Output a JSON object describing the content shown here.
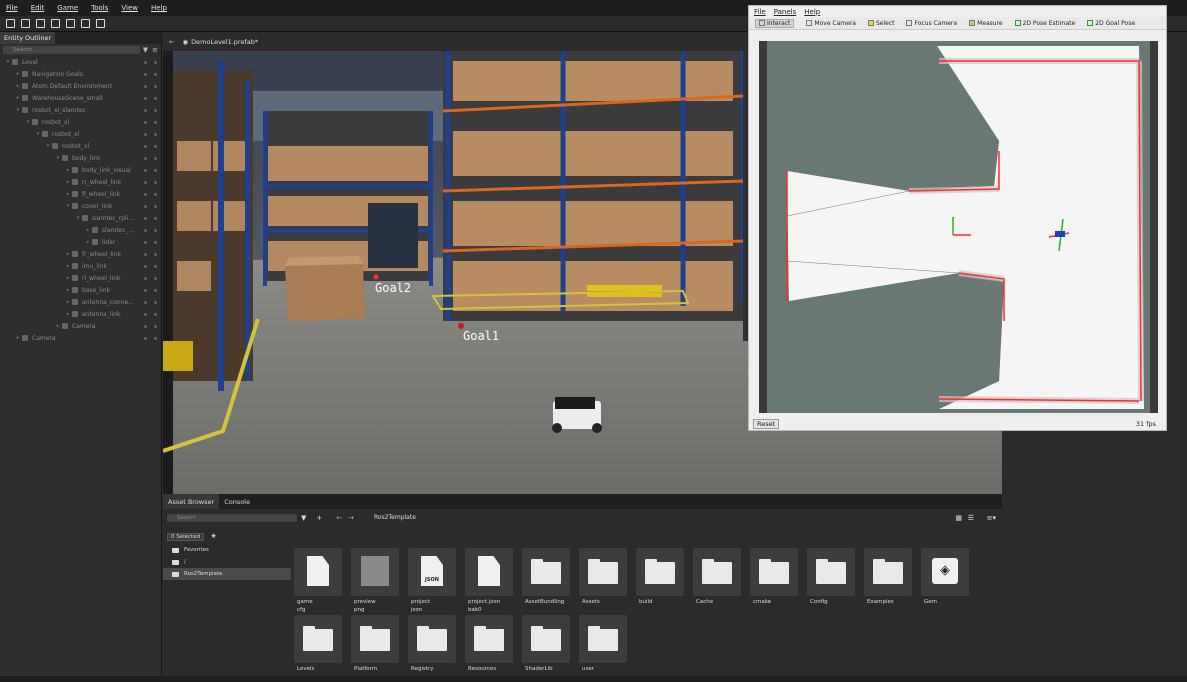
{
  "menu": [
    "File",
    "Edit",
    "Game",
    "Tools",
    "View",
    "Help"
  ],
  "outliner": {
    "tab": "Entity Outliner",
    "search_placeholder": "Search...",
    "items": [
      {
        "label": "Level",
        "indent": 0,
        "expanded": true
      },
      {
        "label": "Navigation Goals",
        "indent": 1
      },
      {
        "label": "Atom Default Environment",
        "indent": 1
      },
      {
        "label": "WarehouseScene_small",
        "indent": 1
      },
      {
        "label": "rosbot_xl_slamtec",
        "indent": 1,
        "expanded": true
      },
      {
        "label": "rosbot_xl",
        "indent": 2,
        "expanded": true
      },
      {
        "label": "rosbot_xl",
        "indent": 3,
        "expanded": true
      },
      {
        "label": "rosbot_xl",
        "indent": 4,
        "expanded": true
      },
      {
        "label": "body_link",
        "indent": 5,
        "expanded": true
      },
      {
        "label": "body_link_visual",
        "indent": 6
      },
      {
        "label": "rr_wheel_link",
        "indent": 6
      },
      {
        "label": "fl_wheel_link",
        "indent": 6
      },
      {
        "label": "cover_link",
        "indent": 6,
        "expanded": true
      },
      {
        "label": "slamtec_rpli...",
        "indent": 7,
        "expanded": true
      },
      {
        "label": "slamtec_...",
        "indent": 8
      },
      {
        "label": "lidar",
        "indent": 8
      },
      {
        "label": "fr_wheel_link",
        "indent": 6
      },
      {
        "label": "imu_link",
        "indent": 6
      },
      {
        "label": "rl_wheel_link",
        "indent": 6
      },
      {
        "label": "base_link",
        "indent": 6
      },
      {
        "label": "antenna_conne...",
        "indent": 6
      },
      {
        "label": "antenna_link",
        "indent": 6
      },
      {
        "label": "Camera",
        "indent": 5
      },
      {
        "label": "Camera",
        "indent": 1
      }
    ]
  },
  "viewport": {
    "title": "DemoLevel1.prefab*",
    "goal2": "Goal2",
    "goal1": "Goal1"
  },
  "rviz": {
    "menu": [
      "File",
      "Panels",
      "Help"
    ],
    "tools": [
      "Interact",
      "Move Camera",
      "Select",
      "Focus Camera",
      "Measure",
      "2D Pose Estimate",
      "2D Goal Pose"
    ],
    "reset": "Reset",
    "fps": "31 fps"
  },
  "assets": {
    "tabs": [
      "Asset Browser",
      "Console"
    ],
    "search_placeholder": "Search",
    "breadcrumb": "Ros2Template",
    "selected_badge": "0 Selected",
    "tree": [
      {
        "label": "Favorites"
      },
      {
        "label": "/"
      },
      {
        "label": "Ros2Template",
        "selected": true
      }
    ],
    "tiles": [
      {
        "type": "doc",
        "label": "game\ncfg"
      },
      {
        "type": "image",
        "label": "preview\npng"
      },
      {
        "type": "json",
        "label": "project\njson"
      },
      {
        "type": "doc",
        "label": "project.json\nbak0"
      },
      {
        "type": "folder",
        "label": "AssetBundling"
      },
      {
        "type": "folder",
        "label": "Assets"
      },
      {
        "type": "folder",
        "label": "build"
      },
      {
        "type": "folder",
        "label": "Cache"
      },
      {
        "type": "folder",
        "label": "cmake"
      },
      {
        "type": "folder",
        "label": "Config"
      },
      {
        "type": "folder",
        "label": "Examples"
      },
      {
        "type": "gem",
        "label": "Gem"
      },
      {
        "type": "folder",
        "label": "Levels"
      },
      {
        "type": "folder",
        "label": "Platform"
      },
      {
        "type": "folder",
        "label": "Registry"
      },
      {
        "type": "folder",
        "label": "Resources"
      },
      {
        "type": "folder",
        "label": "ShaderLib"
      },
      {
        "type": "folder",
        "label": "user"
      }
    ],
    "json_tag": "JSON"
  },
  "colors": {
    "accent": "#ff2a2a",
    "map_free": "#f5f5f5",
    "map_unknown": "#6a7874"
  }
}
